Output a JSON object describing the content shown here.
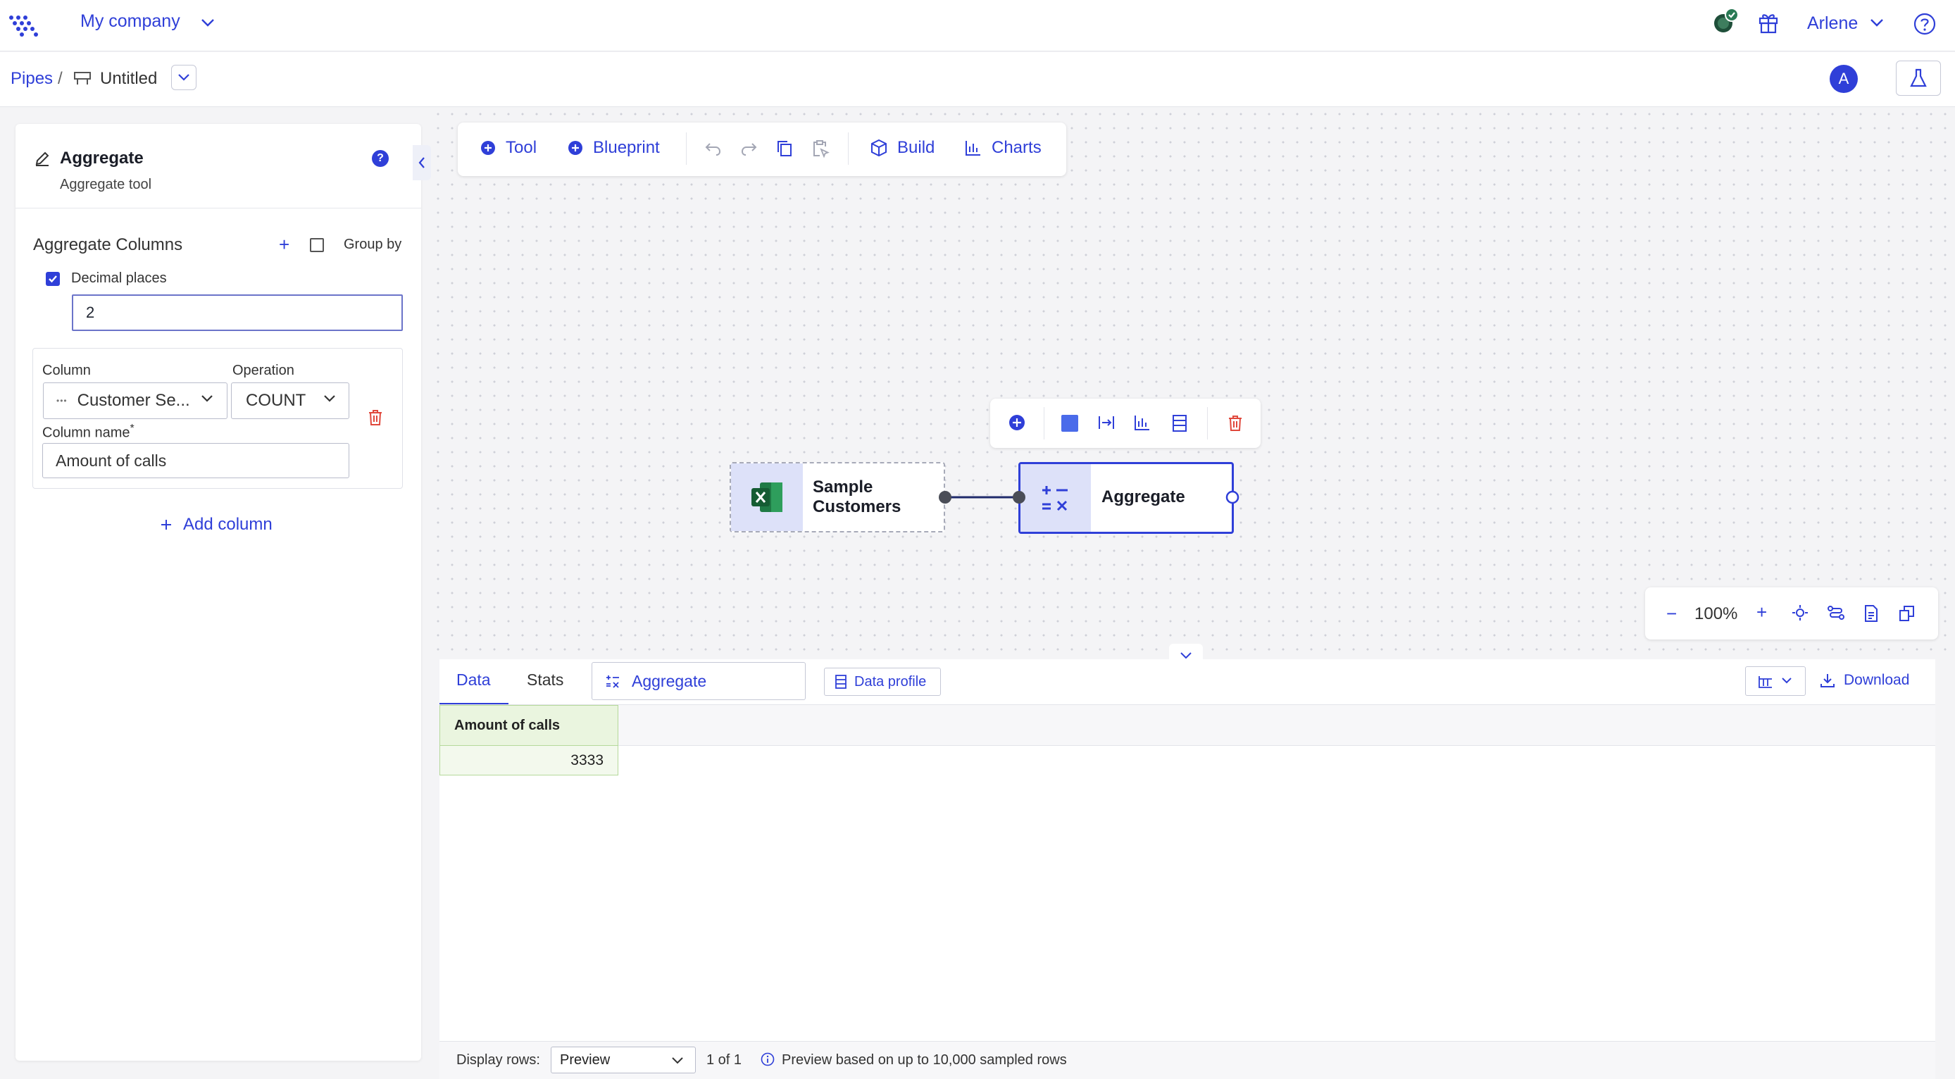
{
  "topbar": {
    "company": "My company",
    "user": "Arlene"
  },
  "breadcrumb": {
    "root": "Pipes",
    "separator": "/",
    "title": "Untitled"
  },
  "avatar_initial": "A",
  "panel": {
    "title": "Aggregate",
    "subtitle": "Aggregate tool",
    "section_label": "Aggregate Columns",
    "add_symbol": "+",
    "group_by_label": "Group by",
    "group_by_checked": false,
    "decimal_places_label": "Decimal places",
    "decimal_places_checked": true,
    "decimal_places_value": "2",
    "column_label": "Column",
    "column_value": "Customer Se...",
    "operation_label": "Operation",
    "operation_value": "COUNT",
    "column_name_label": "Column name",
    "required_mark": "*",
    "column_name_value": "Amount of calls",
    "add_column_label": "Add column",
    "help_symbol": "?"
  },
  "toolbar": {
    "tool_label": "Tool",
    "blueprint_label": "Blueprint",
    "build_label": "Build",
    "charts_label": "Charts"
  },
  "nodes": {
    "source_label_line1": "Sample",
    "source_label_line2": "Customers",
    "aggregate_label": "Aggregate"
  },
  "zoom": {
    "minus": "−",
    "value": "100%",
    "plus": "+"
  },
  "data_panel": {
    "tab_data": "Data",
    "tab_stats": "Stats",
    "tool_tab": "Aggregate",
    "data_profile": "Data profile",
    "download": "Download",
    "columns": [
      "Amount of calls"
    ],
    "rows": [
      [
        "3333"
      ]
    ],
    "display_rows_label": "Display rows:",
    "display_rows_value": "Preview",
    "page_info": "1 of 1",
    "preview_note": "Preview based on up to 10,000 sampled rows"
  },
  "colors": {
    "accent": "#2f3fd8",
    "node_icon_bg": "#dde1f9",
    "excel_green": "#1f7a45",
    "delete_red": "#e0483c",
    "result_column": "#eaf5df"
  }
}
